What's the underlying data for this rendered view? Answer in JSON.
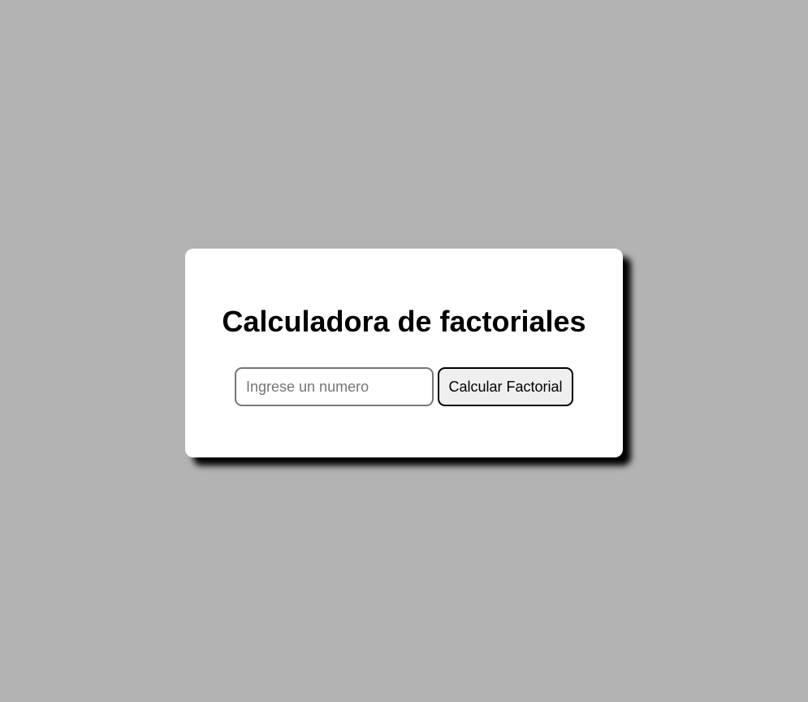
{
  "calculator": {
    "title": "Calculadora de factoriales",
    "input": {
      "value": "",
      "placeholder": "Ingrese un numero"
    },
    "button_label": "Calcular Factorial"
  },
  "colors": {
    "background": "#b3b3b3",
    "card": "#ffffff",
    "shadow": "#000000",
    "button_bg": "#efefef"
  }
}
